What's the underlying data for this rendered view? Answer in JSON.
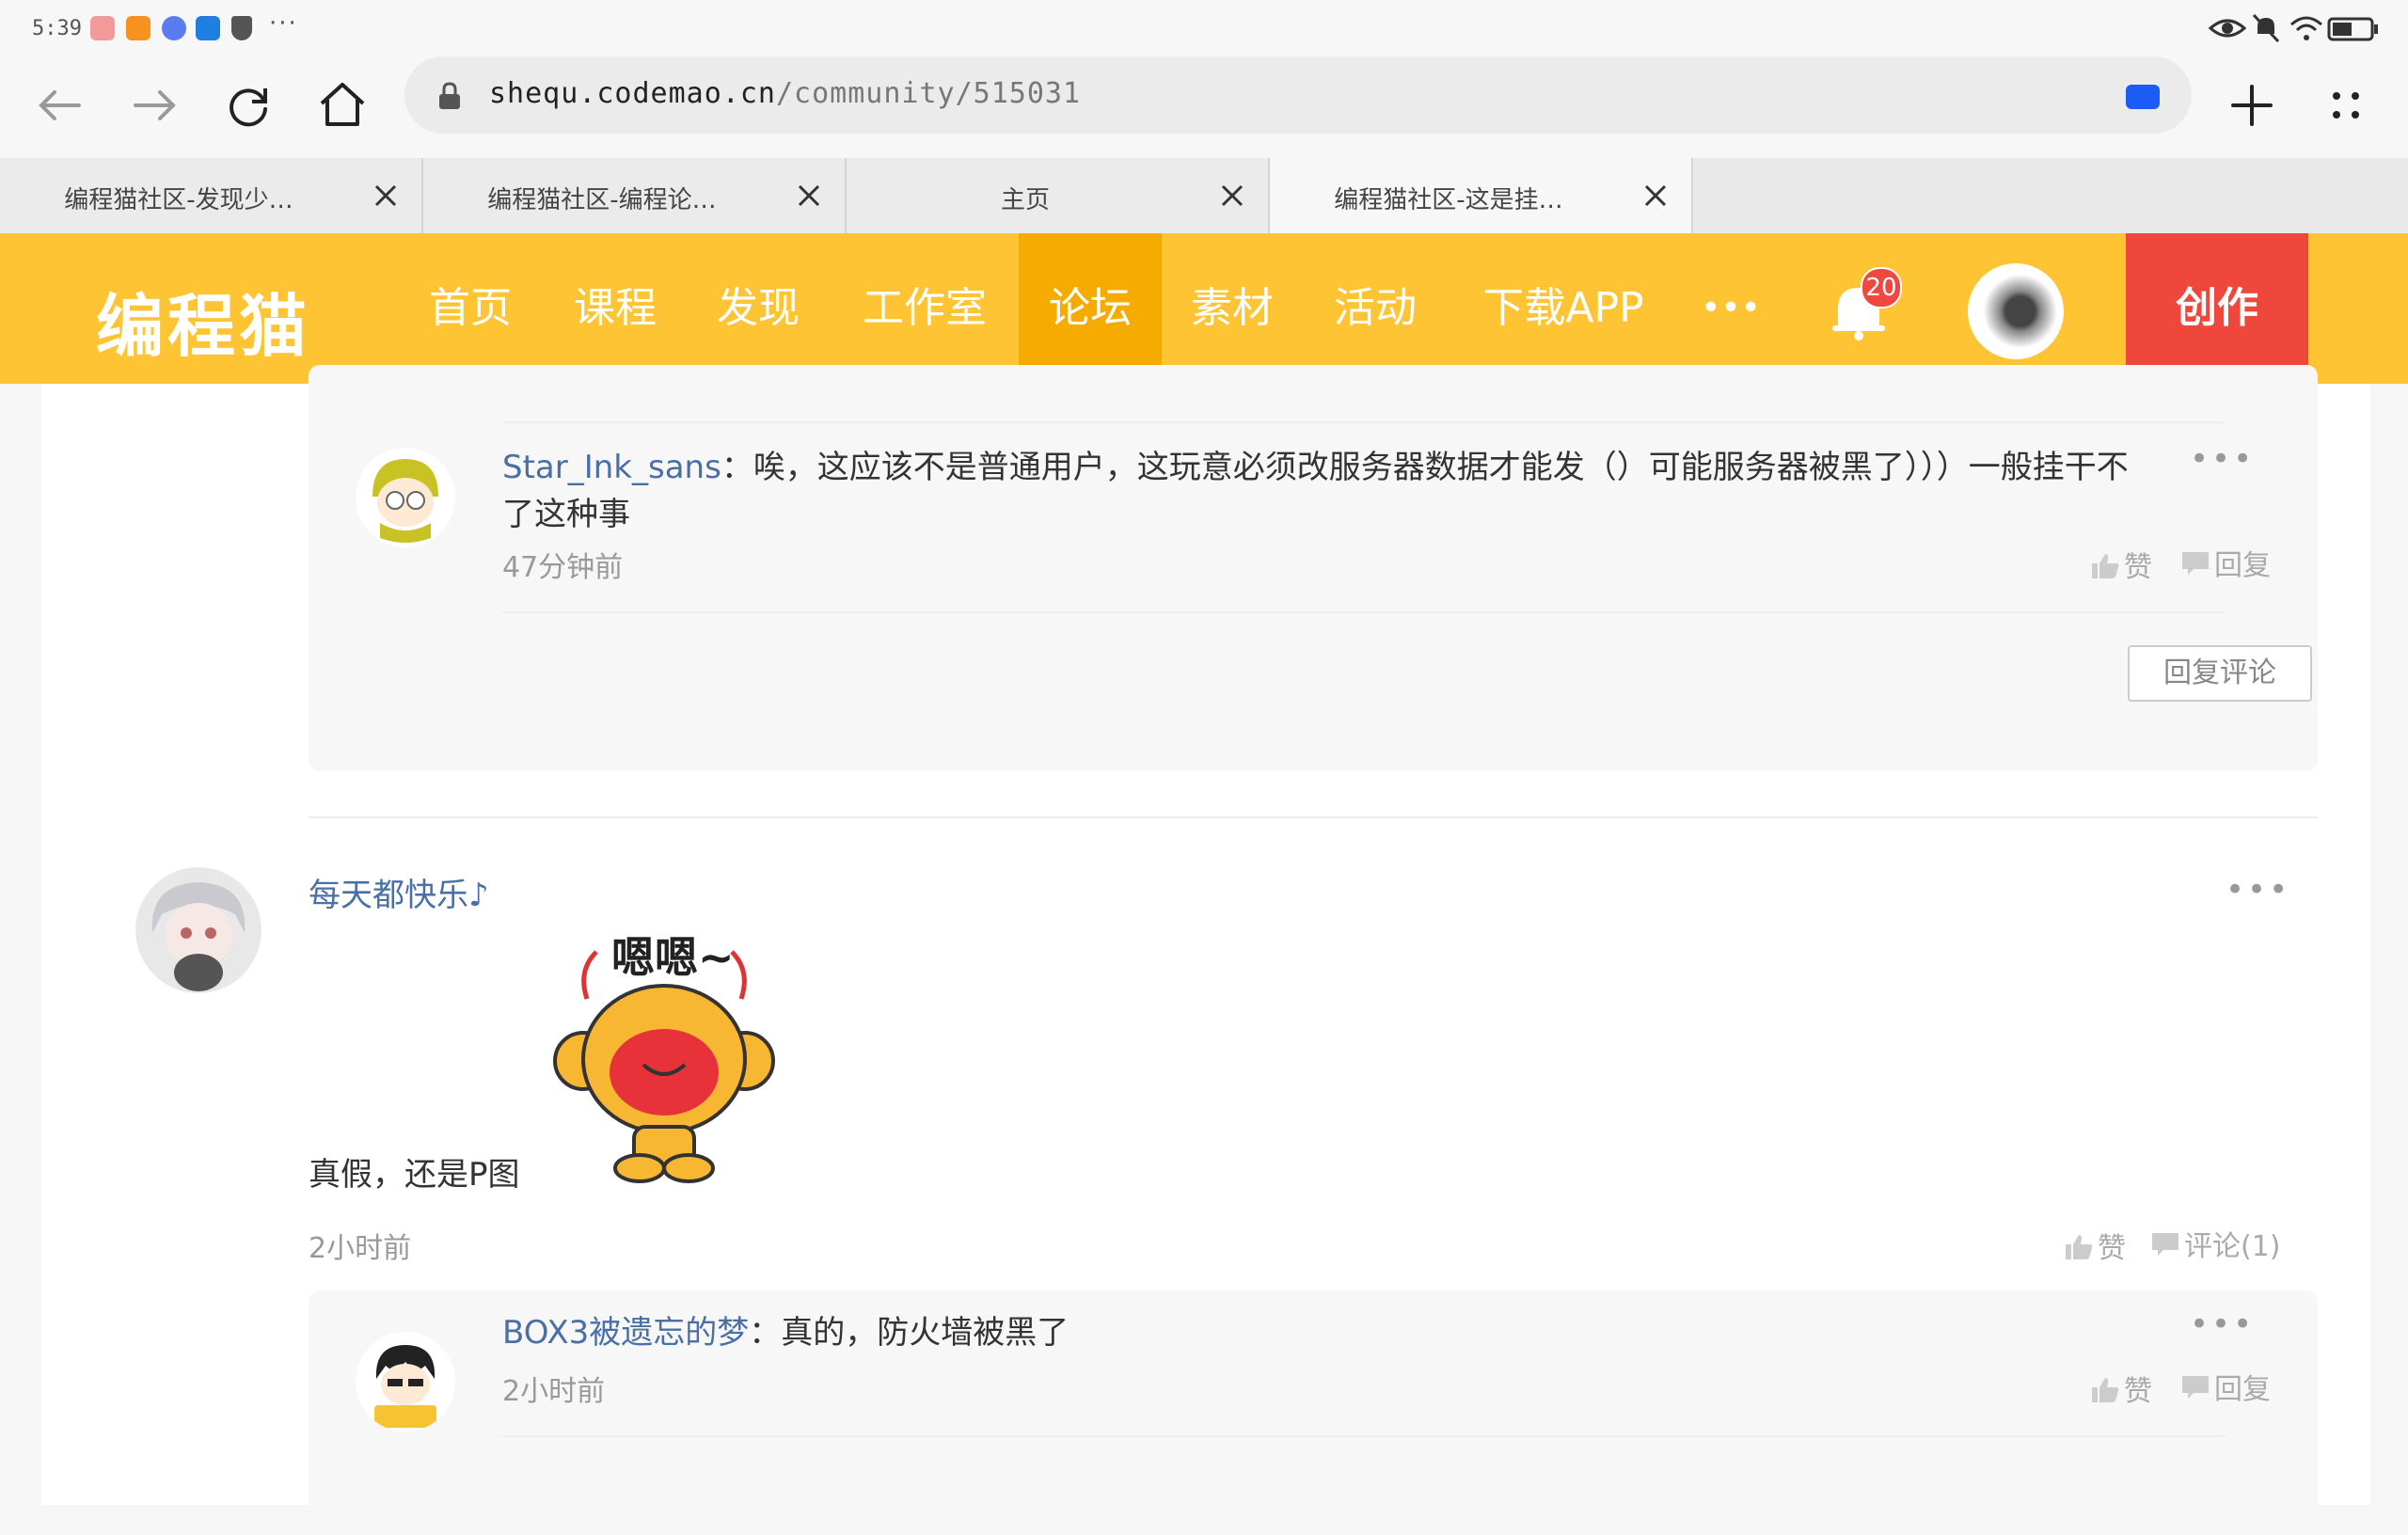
{
  "status_bar": {
    "time": "5:39",
    "more": "···"
  },
  "browser": {
    "url_host": "shequ.codemao.cn",
    "url_path": "/community/515031",
    "tabs": [
      {
        "title": "编程猫社区-发现少…"
      },
      {
        "title": "编程猫社区-编程论…"
      },
      {
        "title": "主页"
      },
      {
        "title": "编程猫社区-这是挂…"
      }
    ]
  },
  "site": {
    "logo": "编程猫",
    "nav": [
      "首页",
      "课程",
      "发现",
      "工作室",
      "论坛",
      "素材",
      "活动",
      "下载APP"
    ],
    "nav_more": "•••",
    "notification_count": "20",
    "create_label": "创作",
    "brand_color": "#fec433",
    "active_nav_color": "#f5ab00",
    "create_color": "#f0473c"
  },
  "comments": {
    "reply1": {
      "user": "Star_Ink_sans",
      "sep": "：",
      "text": "唉，这应该不是普通用户，这玩意必须改服务器数据才能发（）可能服务器被黑了）））一般挂干不了这种事",
      "time": "47分钟前",
      "like": "赞",
      "reply": "回复"
    },
    "reply_comment_button": "回复评论",
    "comment2": {
      "user": "每天都快乐♪",
      "text": "真假，还是P图",
      "sticker_text": "嗯嗯~",
      "time": "2小时前",
      "like": "赞",
      "comment": "评论(1)"
    },
    "reply2": {
      "user": "BOX3被遗忘的梦",
      "sep": "：",
      "text": "真的，防火墙被黑了",
      "time": "2小时前",
      "like": "赞",
      "reply": "回复"
    },
    "more": "•••"
  }
}
